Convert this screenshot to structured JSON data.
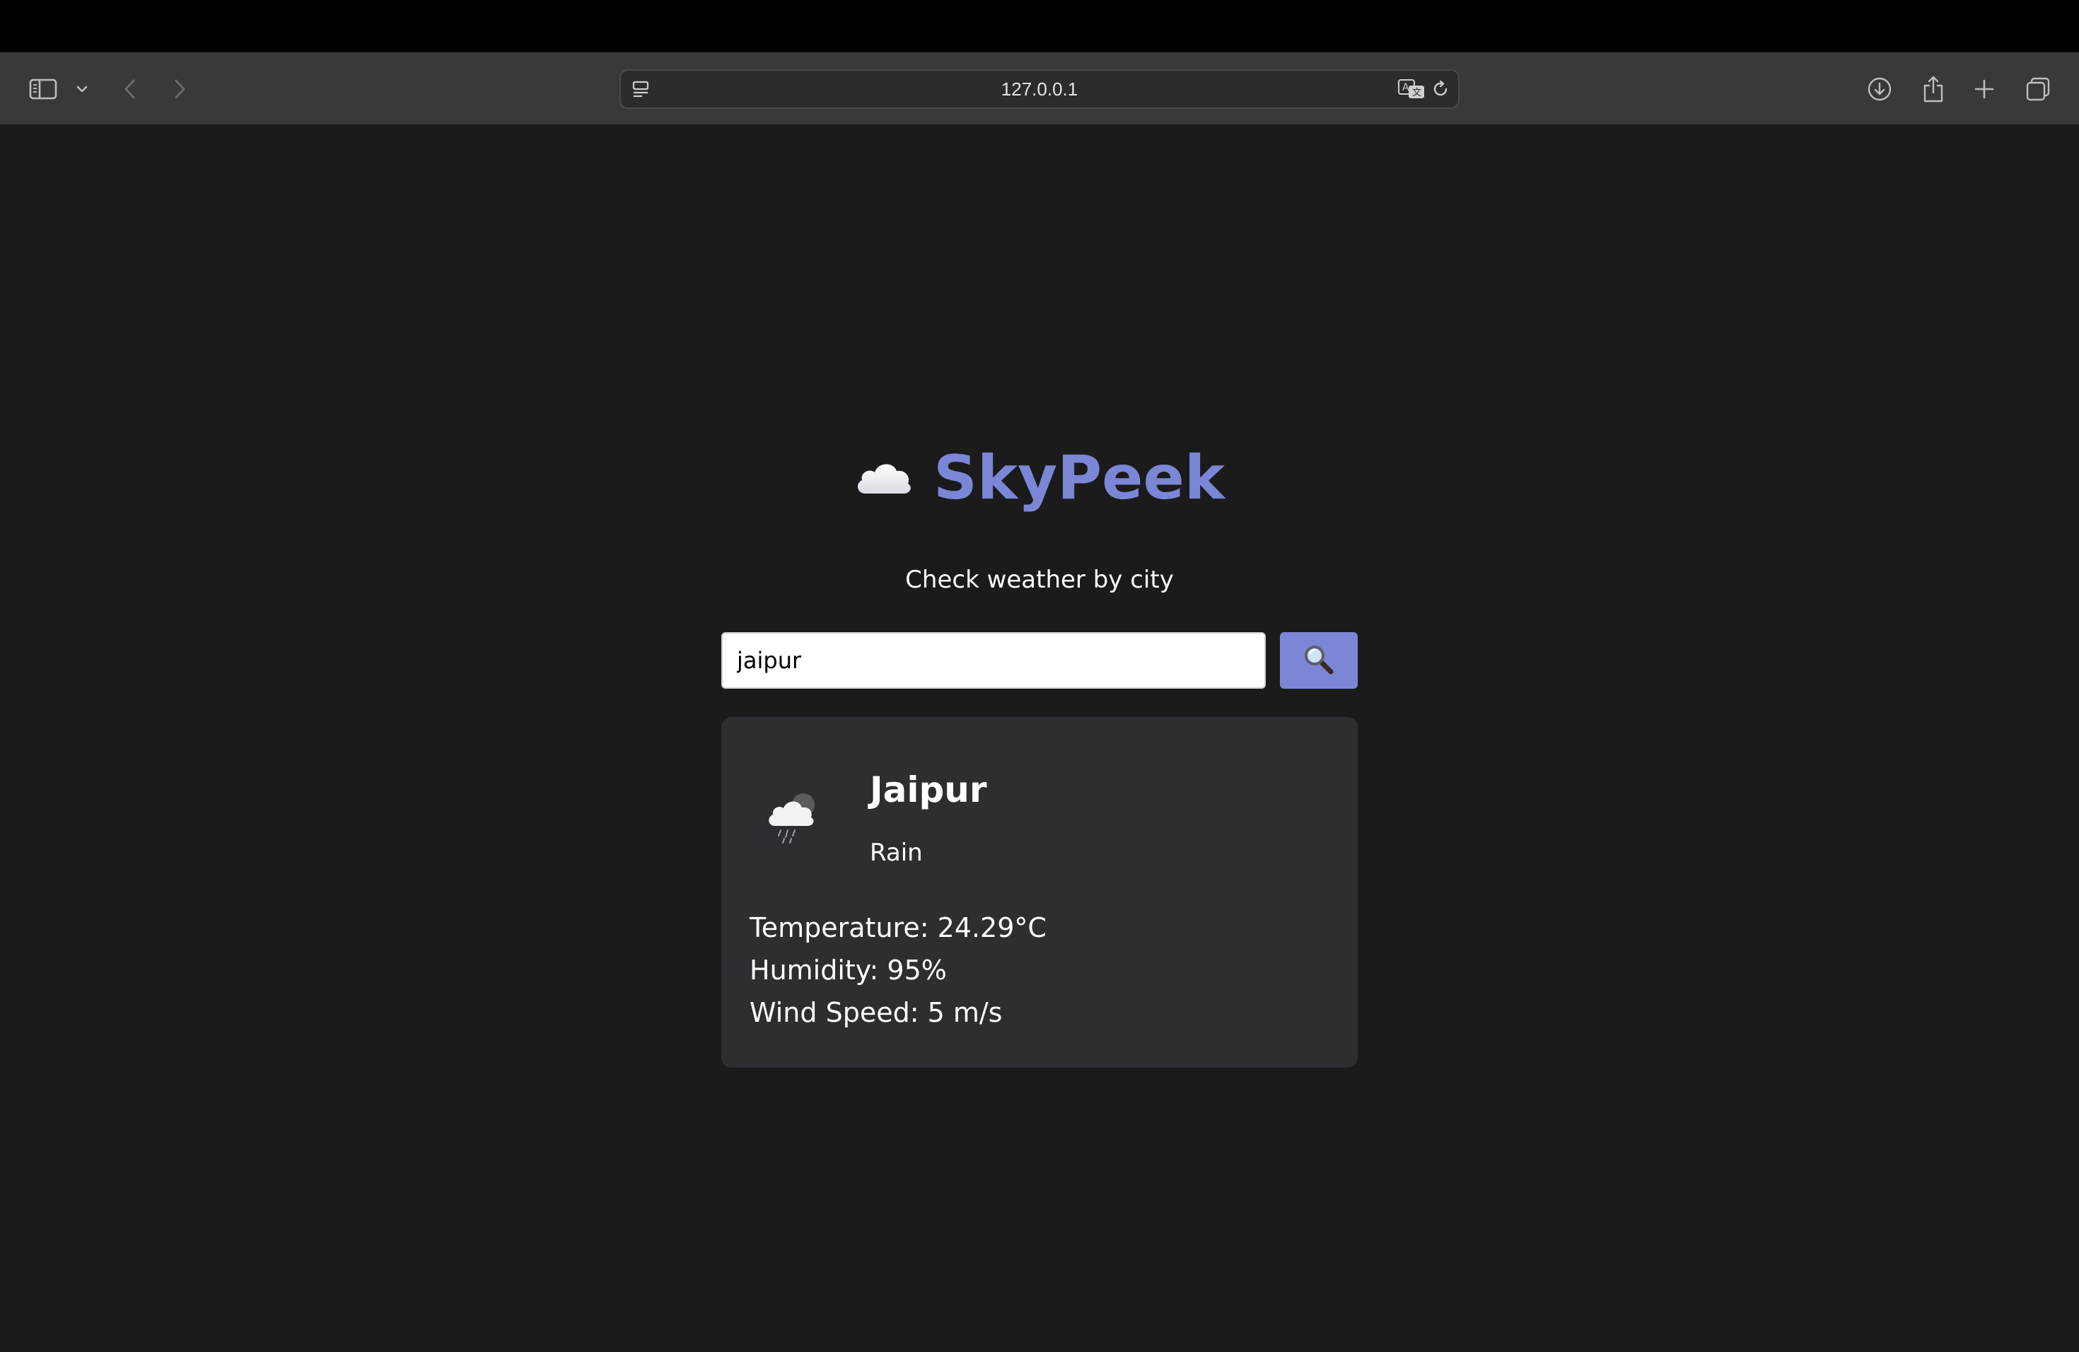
{
  "browser": {
    "url": "127.0.0.1",
    "icons": [
      "sidebar-icon",
      "chevron-down-icon",
      "back-arrow-icon",
      "forward-arrow-icon",
      "page-menu-icon",
      "translate-icon",
      "reload-icon",
      "download-icon",
      "share-icon",
      "new-tab-icon",
      "tab-overview-icon"
    ]
  },
  "app": {
    "title_emoji": "cloud-icon",
    "title": "SkyPeek",
    "subtitle": "Check weather by city",
    "accent_color": "#7b86d6"
  },
  "search": {
    "value": "jaipur",
    "button_icon": "magnifier-icon"
  },
  "weather": {
    "icon": "rain-cloud-icon",
    "city": "Jaipur",
    "condition": "Rain",
    "temperature": "Temperature: 24.29°C",
    "humidity": "Humidity: 95%",
    "wind_speed": "Wind Speed: 5 m/s"
  }
}
